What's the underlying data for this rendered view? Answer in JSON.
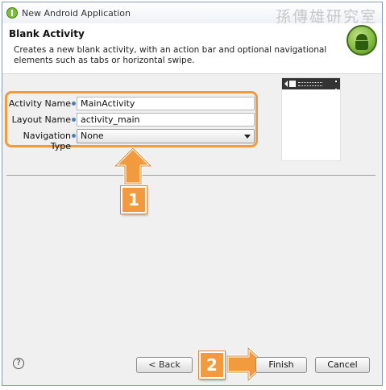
{
  "window": {
    "title": "New Android Application",
    "watermark": "孫傳雄研究室"
  },
  "header": {
    "title": "Blank Activity",
    "description": "Creates a new blank activity, with an action bar and optional navigational elements such as tabs or horizontal swipe."
  },
  "form": {
    "activity_name_label": "Activity Name",
    "activity_name_value": "MainActivity",
    "layout_name_label": "Layout Name",
    "layout_name_value": "activity_main",
    "navigation_type_label": "Navigation Type",
    "navigation_type_value": "None"
  },
  "annotations": {
    "step1": "1",
    "step2": "2",
    "color": "#f19a3e"
  },
  "footer": {
    "help_icon_glyph": "?",
    "back_label": "< Back",
    "finish_label": "Finish",
    "cancel_label": "Cancel"
  }
}
